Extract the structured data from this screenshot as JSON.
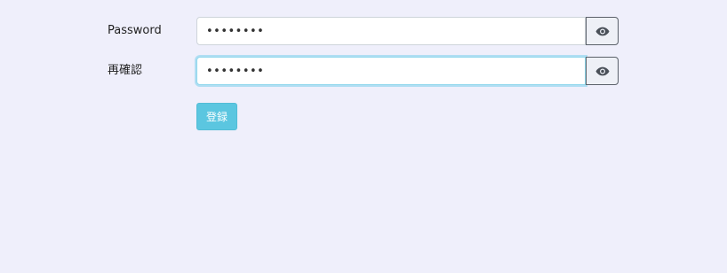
{
  "form": {
    "password": {
      "label": "Password",
      "value": "••••••••",
      "input_type": "password",
      "toggle_icon": "eye-icon"
    },
    "confirm": {
      "label": "再確認",
      "value": "••••••••",
      "input_type": "password",
      "toggle_icon": "eye-icon",
      "focused": true
    },
    "submit_label": "登録"
  },
  "colors": {
    "background": "#efeffb",
    "button_accent": "#5bc6e0",
    "focus_ring": "#8fd7ec"
  }
}
